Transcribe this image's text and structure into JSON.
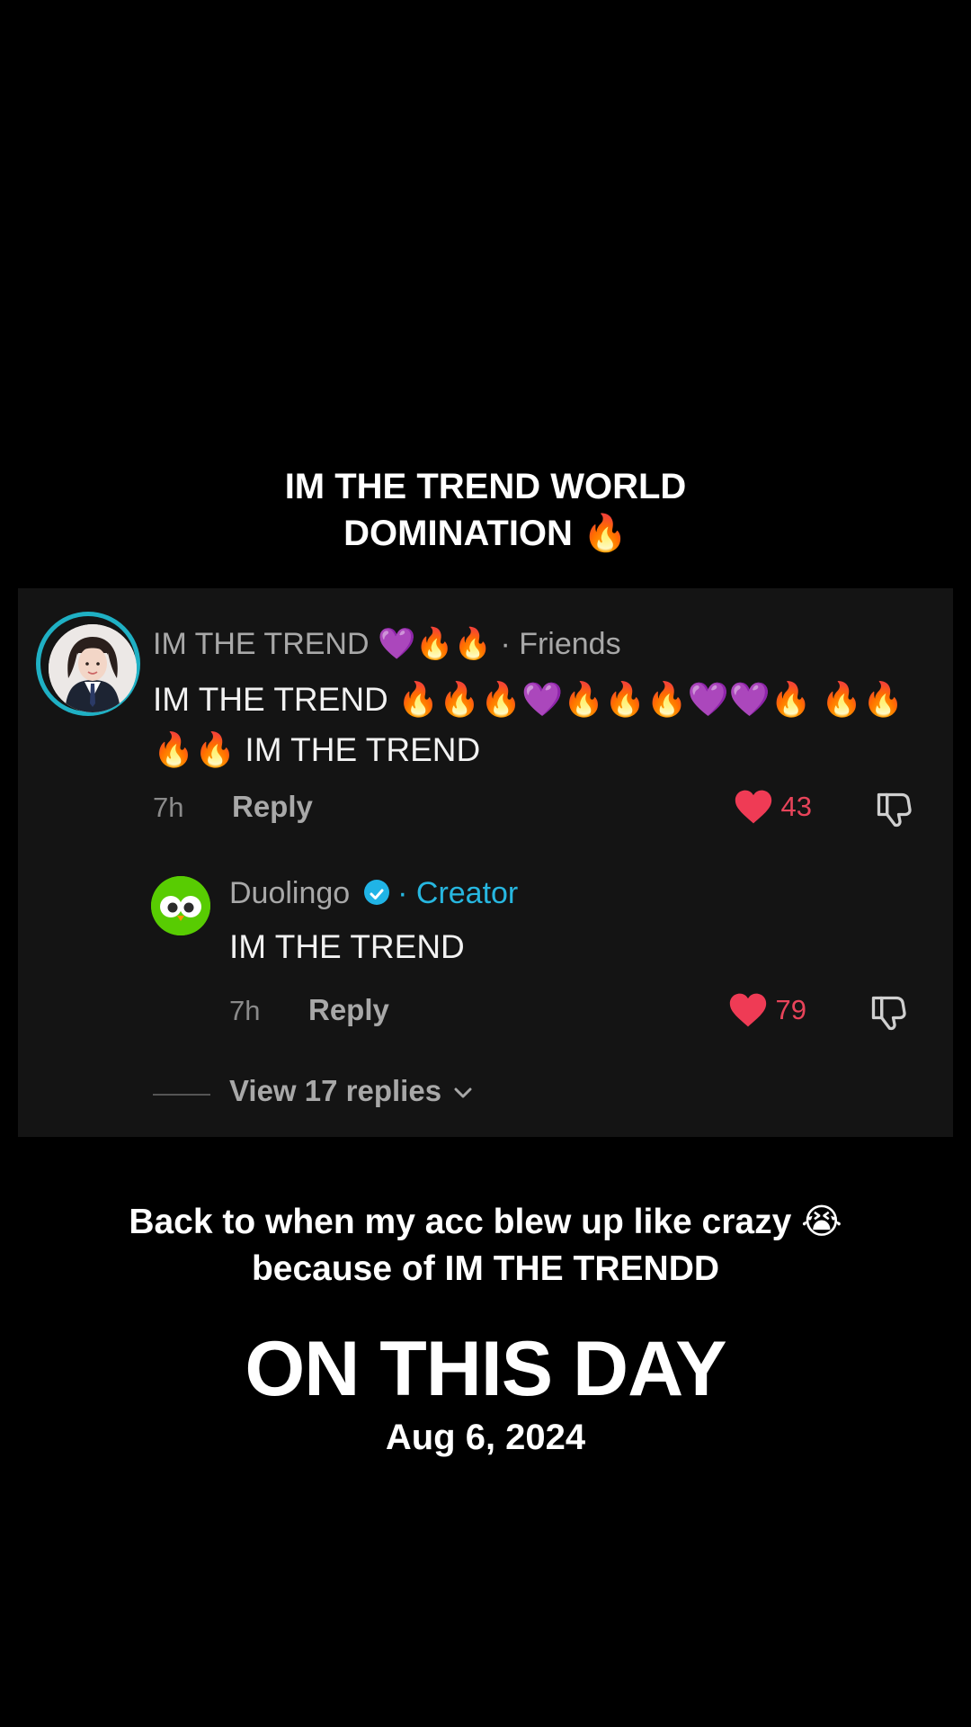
{
  "top_caption": {
    "line1": "IM THE TREND WORLD",
    "line2": "DOMINATION 🔥"
  },
  "comment": {
    "username": "IM THE TREND 💜🔥🔥",
    "tag": " · Friends",
    "text": "IM THE TREND 🔥🔥🔥💜🔥🔥🔥💜💜🔥 🔥🔥🔥🔥 IM THE TREND",
    "time": "7h",
    "reply_label": "Reply",
    "likes": "43"
  },
  "reply": {
    "username": "Duolingo",
    "tag": " · Creator",
    "text": "IM THE TREND",
    "time": "7h",
    "reply_label": "Reply",
    "likes": "79"
  },
  "view_replies": "View 17 replies",
  "bottom_caption": {
    "line1": "Back to when my acc blew up like crazy 😭",
    "line2": "because of IM THE TRENDD"
  },
  "title": "ON THIS DAY",
  "date": "Aug 6, 2024",
  "colors": {
    "background": "#000000",
    "card": "#141414",
    "like": "#e8445a",
    "creator": "#27b7e0",
    "avatar_ring": "#1fb0c4",
    "duolingo_green": "#58cc02"
  }
}
